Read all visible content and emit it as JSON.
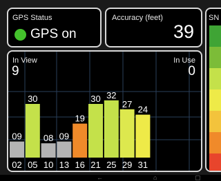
{
  "gps_status": {
    "title": "GPS Status",
    "status": "GPS on",
    "indicator_color": "#44c22c"
  },
  "accuracy": {
    "title": "Accuracy (feet)",
    "value": "39"
  },
  "satellites": {
    "in_view_label": "In View",
    "in_view_value": "9",
    "in_use_label": "In Use",
    "in_use_value": "0"
  },
  "snr_panel": {
    "title": "SN"
  },
  "chart_data": {
    "type": "bar",
    "categories": [
      "02",
      "05",
      "10",
      "13",
      "16",
      "21",
      "25",
      "29",
      "31"
    ],
    "values": [
      9,
      30,
      8,
      9,
      19,
      30,
      32,
      27,
      24
    ],
    "value_labels": [
      "09",
      "30",
      "08",
      "09",
      "19",
      "30",
      "32",
      "27",
      "24"
    ],
    "bar_colors": [
      "#b4b4b4",
      "#c4e14a",
      "#b4b4b4",
      "#b4b4b4",
      "#f08a2a",
      "#c4e14a",
      "#c4e14a",
      "#dde84e",
      "#eeea48"
    ],
    "ylim": [
      0,
      50
    ]
  },
  "snr_scale_colors": [
    "#3fa435",
    "#7cbc38",
    "#c4e14a",
    "#eeea48",
    "#f3c33c",
    "#f08a2a",
    "#e8452c"
  ]
}
